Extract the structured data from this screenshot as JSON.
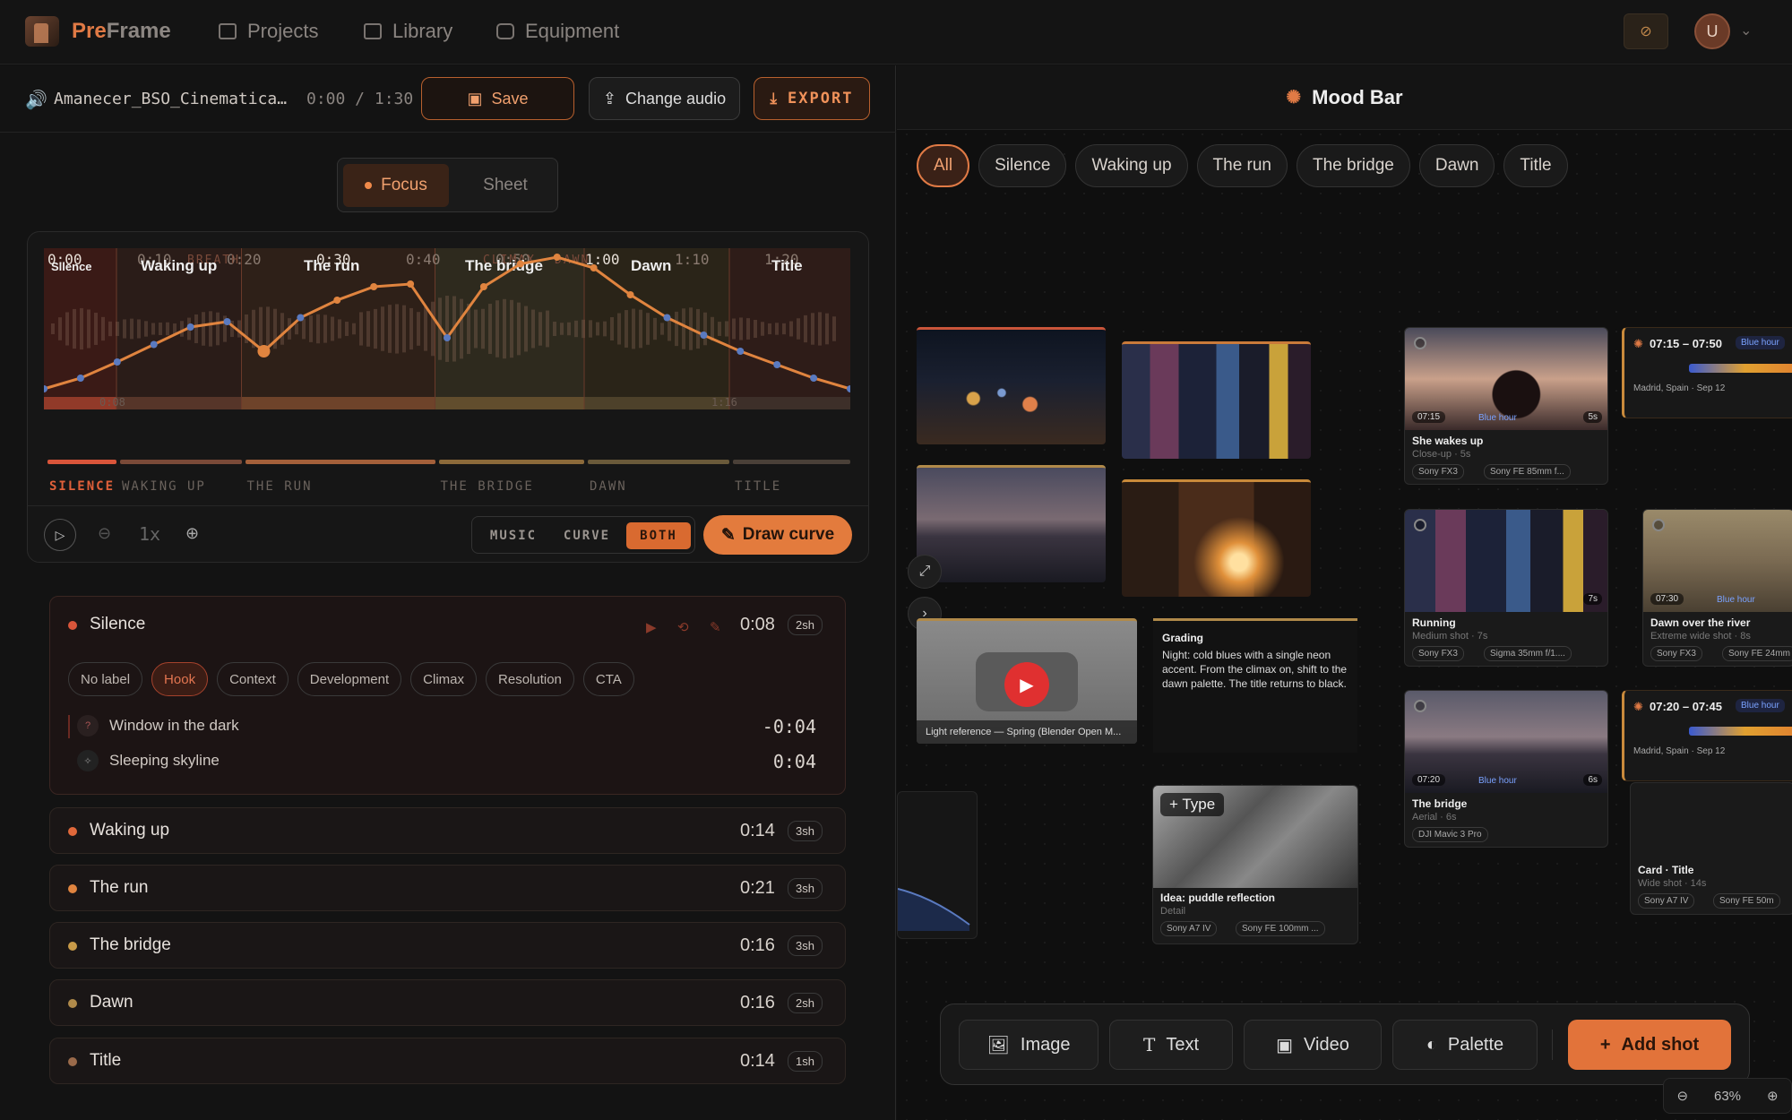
{
  "app": {
    "logo_pre": "Pre",
    "logo_frame": "Frame",
    "nav": [
      "Projects",
      "Library",
      "Equipment"
    ],
    "avatar_initial": "U"
  },
  "toolbar": {
    "track_name": "Amanecer_BSO_Cinematica…",
    "track_time": "0:00 / 1:30",
    "save_label": "Save",
    "change_label": "Change audio",
    "export_label": "EXPORT"
  },
  "view_toggle": {
    "focus": "Focus",
    "sheet": "Sheet"
  },
  "timeline": {
    "ticks": [
      "0:00",
      "0:10",
      "0:20",
      "0:30",
      "0:40",
      "0:50",
      "1:00",
      "1:10",
      "1:20"
    ],
    "markers": [
      "BREATH",
      "CLIMAX",
      "DAWN"
    ],
    "section_labels": [
      "Silence",
      "Waking up",
      "The run",
      "The bridge",
      "Dawn",
      "Title"
    ],
    "segment_names": [
      "SILENCE",
      "WAKING UP",
      "THE RUN",
      "THE BRIDGE",
      "DAWN",
      "TITLE"
    ],
    "segment_colors": [
      "#d9553a",
      "#7a4a38",
      "#a4603a",
      "#8c6a3a",
      "#6a5a3a",
      "#4a4038"
    ],
    "bottom_left_tick": "0:08",
    "bottom_right_tick": "1:16",
    "curve_values": [
      0.02,
      0.1,
      0.22,
      0.35,
      0.48,
      0.52,
      0.3,
      0.55,
      0.68,
      0.78,
      0.8,
      0.4,
      0.78,
      0.95,
      1.0,
      0.92,
      0.72,
      0.55,
      0.42,
      0.3,
      0.2,
      0.1,
      0.02
    ],
    "zoom": "1x",
    "modes": [
      "MUSIC",
      "CURVE",
      "BOTH"
    ],
    "draw_label": "Draw curve"
  },
  "sections": [
    {
      "name": "Silence",
      "time": "0:08",
      "shots": "2sh",
      "color": "#d9553a",
      "chips": [
        "No label",
        "Hook",
        "Context",
        "Development",
        "Climax",
        "Resolution",
        "CTA"
      ],
      "beats": [
        {
          "label": "Window in the dark",
          "time": "-0:04"
        },
        {
          "label": "Sleeping skyline",
          "time": "0:04"
        }
      ]
    },
    {
      "name": "Waking up",
      "time": "0:14",
      "shots": "3sh",
      "color": "#e0683a"
    },
    {
      "name": "The run",
      "time": "0:21",
      "shots": "3sh",
      "color": "#e0843f"
    },
    {
      "name": "The bridge",
      "time": "0:16",
      "shots": "3sh",
      "color": "#c89a48"
    },
    {
      "name": "Dawn",
      "time": "0:16",
      "shots": "2sh",
      "color": "#b08a4a"
    },
    {
      "name": "Title",
      "time": "0:14",
      "shots": "1sh",
      "color": "#9a6a4a"
    }
  ],
  "mood": {
    "title": "Mood Bar",
    "filters": [
      "All",
      "Silence",
      "Waking up",
      "The run",
      "The bridge",
      "Dawn",
      "Title"
    ],
    "grading_title": "Grading",
    "grading_text": "Night: cold blues with a single neon accent. From the climax on, shift to the dawn palette. The title returns to black.",
    "video_caption": "Light reference — Spring (Blender Open M...",
    "idea_title": "Idea: puddle reflection",
    "idea_sub": "Detail",
    "idea_tags": [
      "Sony A7 IV",
      "Sony FE 100mm ..."
    ],
    "type_label": "+ Type",
    "shots": [
      {
        "title": "She wakes up",
        "sub": "Close-up · 5s",
        "time": "07:15",
        "tag": "Blue hour",
        "dur": "5s",
        "cam": "Sony FX3",
        "lens": "Sony FE 85mm f..."
      },
      {
        "title": "Running",
        "sub": "Medium shot · 7s",
        "dur": "7s",
        "cam": "Sony FX3",
        "lens": "Sigma 35mm f/1...."
      },
      {
        "title": "Dawn over the river",
        "sub": "Extreme wide shot · 8s",
        "time": "07:30",
        "tag": "Blue hour",
        "cam": "Sony FX3",
        "lens": "Sony FE 24mm"
      },
      {
        "title": "The bridge",
        "sub": "Aerial · 6s",
        "time": "07:20",
        "tag": "Blue hour",
        "dur": "6s",
        "cam": "DJI Mavic 3 Pro"
      },
      {
        "title": "Card · Title",
        "sub": "Wide shot · 14s",
        "cam": "Sony A7 IV",
        "lens": "Sony FE 50m"
      }
    ],
    "light_cards": [
      {
        "range": "07:15 – 07:50",
        "tag": "Blue hour",
        "place": "Madrid, Spain · Sep 12"
      },
      {
        "range": "07:20 – 07:45",
        "tag": "Blue hour",
        "place": "Madrid, Spain · Sep 12"
      }
    ],
    "bottom_buttons": [
      "Image",
      "Text",
      "Video",
      "Palette"
    ],
    "add_label": "Add shot",
    "zoom": "63%"
  }
}
